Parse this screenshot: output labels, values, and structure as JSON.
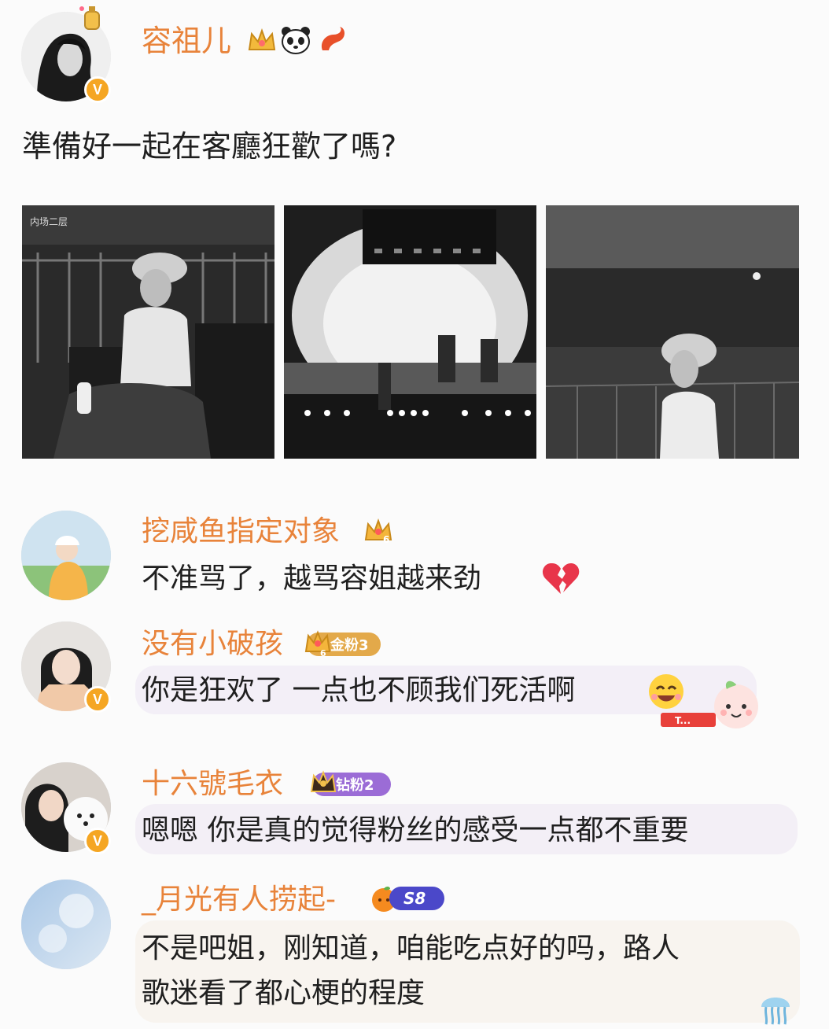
{
  "post": {
    "author": "容祖儿",
    "verified_mark": "V",
    "text": "準備好一起在客廳狂歡了嗎?"
  },
  "comments": [
    {
      "name": "挖咸鱼指定对象",
      "text": "不准骂了，越骂容姐越来劲",
      "badge_level": "6"
    },
    {
      "name": "没有小破孩",
      "badge_label": "金粉3",
      "badge_level": "6",
      "text": "你是狂欢了 一点也不顾我们死活啊"
    },
    {
      "name": "十六號毛衣",
      "badge_label": "钻粉2",
      "text": "嗯嗯 你是真的觉得粉丝的感受一点都不重要"
    },
    {
      "name": "_月光有人捞起-",
      "badge_label": "S8",
      "text_line1": "不是吧姐，刚知道，咱能吃点好的吗，路人",
      "text_line2": "歌迷看了都心梗的程度"
    }
  ],
  "colors": {
    "name": "#e8833a",
    "text": "#1f1f1f",
    "verified": "#f5a623",
    "gold_badge": "#e3a94a",
    "diamond_badge": "#9b6cd6",
    "s8_badge": "#4b48c9"
  }
}
